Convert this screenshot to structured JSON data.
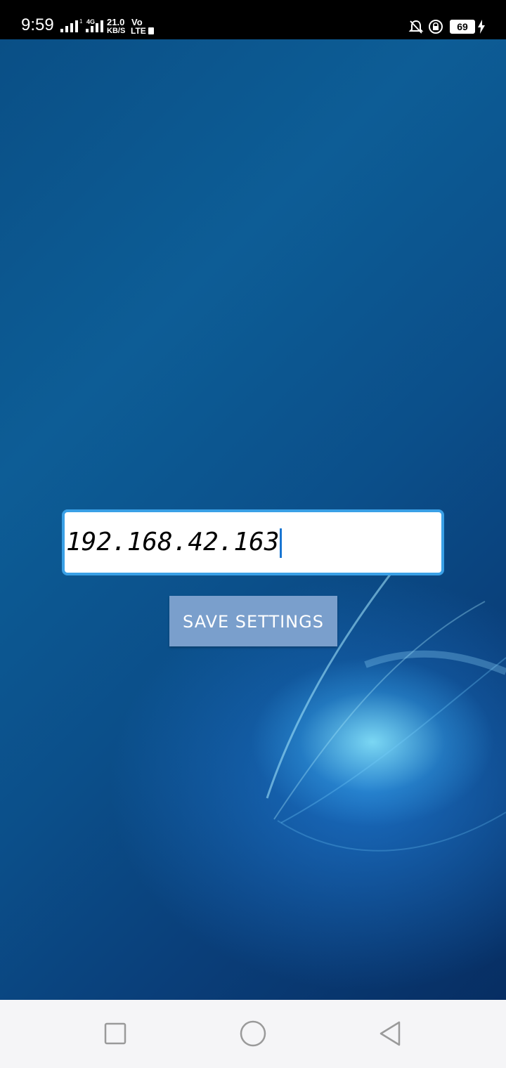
{
  "status_bar": {
    "time": "9:59",
    "net_speed_value": "21.0",
    "net_speed_unit": "KB/S",
    "volte_top": "Vo",
    "volte_bottom": "LTE",
    "network_type": "4G",
    "battery_level": "69"
  },
  "settings": {
    "ip_value": "192.168.42.163",
    "save_label": "SAVE SETTINGS"
  },
  "nav_bar": {
    "recents_icon": "square-icon",
    "home_icon": "circle-icon",
    "back_icon": "triangle-icon"
  }
}
